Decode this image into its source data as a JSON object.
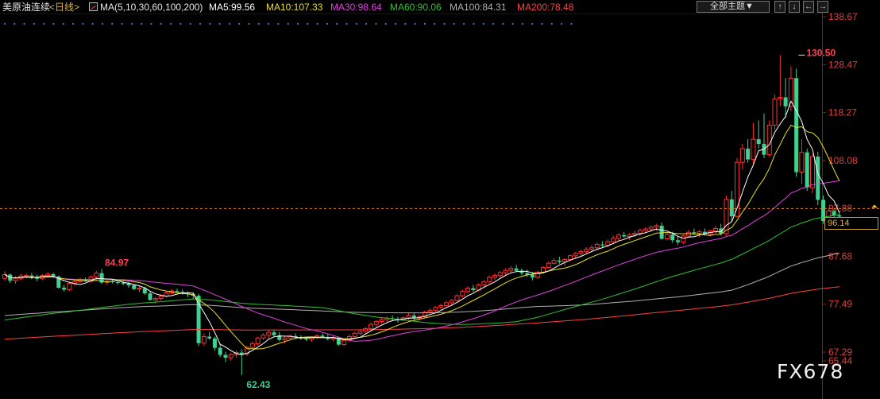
{
  "header": {
    "title": "美原油连续",
    "period": "<日线>",
    "ma_params": "MA(5,10,30,60,100,200)",
    "ma5": "MA5:99.56",
    "ma10": "MA10:107.33",
    "ma30": "MA30:98.64",
    "ma60": "MA60:90.06",
    "ma100": "MA100:84.31",
    "ma200": "MA200:78.48",
    "theme_select": "全部主题▼",
    "btn_up": "↑",
    "btn_down": "↓",
    "btn_left": "←",
    "btn_right": "→"
  },
  "current_price": "96.14",
  "watermark": "FX678",
  "colors": {
    "up": "#ff3030",
    "down": "#40d090",
    "ma5": "#ffffff",
    "ma10": "#e8e020",
    "ma30": "#e040e0",
    "ma60": "#30c030",
    "ma100": "#b0b0b0",
    "ma200": "#ff4040"
  },
  "chart_data": {
    "type": "candlestick",
    "yticks": [
      "138.67",
      "128.47",
      "118.27",
      "108.08",
      "97.88",
      "87.68",
      "77.49",
      "67.29",
      "65.44"
    ],
    "ylim": [
      65.4,
      140.2
    ],
    "annotations": [
      {
        "label": "84.97",
        "value": 84.97,
        "index": 18
      },
      {
        "label": "130.50",
        "value": 130.5,
        "index": 148
      },
      {
        "label": "62.43",
        "value": 62.43,
        "index": 44
      }
    ],
    "candles": [
      [
        83,
        84.5,
        82.5,
        83.8
      ],
      [
        83.8,
        84,
        82,
        82.5
      ],
      [
        82.5,
        83.5,
        81.8,
        83
      ],
      [
        83,
        84,
        82.6,
        83.5
      ],
      [
        83.5,
        84,
        83,
        83.6
      ],
      [
        83.6,
        84.2,
        82.8,
        83.2
      ],
      [
        83.2,
        83.8,
        82.4,
        82.9
      ],
      [
        82.9,
        83.9,
        82.6,
        83.6
      ],
      [
        83.6,
        84.3,
        83.1,
        83.9
      ],
      [
        83.9,
        84.2,
        83.1,
        83.4
      ],
      [
        83.4,
        83.6,
        80.8,
        81
      ],
      [
        81,
        81.6,
        80.2,
        80.6
      ],
      [
        80.6,
        82.1,
        80.3,
        81.9
      ],
      [
        81.9,
        82.6,
        81.4,
        82.3
      ],
      [
        82.3,
        83.1,
        82,
        82.7
      ],
      [
        82.7,
        83.2,
        82.2,
        82.4
      ],
      [
        82.4,
        83.6,
        82.1,
        83.3
      ],
      [
        83.3,
        84.6,
        82.9,
        84.1
      ],
      [
        84.1,
        84.97,
        81.8,
        82.1
      ],
      [
        82.1,
        82.8,
        81.6,
        82.4
      ],
      [
        82.4,
        82.9,
        81.9,
        82.2
      ],
      [
        82.2,
        82.6,
        81.7,
        82
      ],
      [
        82,
        82.4,
        81.5,
        81.9
      ],
      [
        81.9,
        82.2,
        81,
        81.5
      ],
      [
        81.5,
        81.8,
        80.5,
        80.7
      ],
      [
        80.7,
        81.3,
        80,
        80.9
      ],
      [
        80.9,
        81.2,
        79.5,
        79.8
      ],
      [
        79.8,
        80.3,
        78.2,
        78.4
      ],
      [
        78.4,
        79.1,
        77.6,
        78.7
      ],
      [
        78.7,
        79.6,
        78.3,
        79.2
      ],
      [
        79.2,
        80.2,
        78.9,
        79.9
      ],
      [
        79.9,
        80.7,
        79.5,
        80.3
      ],
      [
        80.3,
        80.8,
        79.9,
        80.1
      ],
      [
        80.1,
        80.6,
        79.5,
        79.8
      ],
      [
        79.8,
        80.2,
        79,
        79.6
      ],
      [
        79.6,
        80,
        78.6,
        79.3
      ],
      [
        79.3,
        79.7,
        68.6,
        69.2
      ],
      [
        69.2,
        71.3,
        68.7,
        70.6
      ],
      [
        70.6,
        71.6,
        69.9,
        70.2
      ],
      [
        70.2,
        70.6,
        67.6,
        68.2
      ],
      [
        68.2,
        69.1,
        66.2,
        66.7
      ],
      [
        66.7,
        67.4,
        65.2,
        66.1
      ],
      [
        66.1,
        67.1,
        65.5,
        66.8
      ],
      [
        66.8,
        67.6,
        66.1,
        67.2
      ],
      [
        67.2,
        67.9,
        62.43,
        66.9
      ],
      [
        66.9,
        68.6,
        66.5,
        68.3
      ],
      [
        68.3,
        69.6,
        67.9,
        69.1
      ],
      [
        69.1,
        70.6,
        68.7,
        70.3
      ],
      [
        70.3,
        71.3,
        69.9,
        70.9
      ],
      [
        70.9,
        71.9,
        70.1,
        71.5
      ],
      [
        71.5,
        72.1,
        70.6,
        70.9
      ],
      [
        70.9,
        71.6,
        69.6,
        69.9
      ],
      [
        69.9,
        70.6,
        69.1,
        70.3
      ],
      [
        70.3,
        71.1,
        69.9,
        70.7
      ],
      [
        70.7,
        71.3,
        70.1,
        70.5
      ],
      [
        70.5,
        70.9,
        69.9,
        70.2
      ],
      [
        70.2,
        70.6,
        69.6,
        70
      ],
      [
        70,
        70.6,
        69.5,
        70.4
      ],
      [
        70.4,
        71.1,
        70.1,
        70.8
      ],
      [
        70.8,
        71.3,
        70.3,
        70.5
      ],
      [
        70.5,
        71.1,
        69.8,
        70.1
      ],
      [
        70.1,
        70.7,
        69.6,
        70.4
      ],
      [
        70.4,
        70.6,
        68.6,
        68.9
      ],
      [
        68.9,
        70.1,
        68.6,
        69.8
      ],
      [
        69.8,
        71.1,
        69.4,
        70.6
      ],
      [
        70.6,
        71.6,
        70.1,
        71.3
      ],
      [
        71.3,
        72.1,
        70.9,
        71.7
      ],
      [
        71.7,
        72.6,
        71.2,
        72.3
      ],
      [
        72.3,
        73.6,
        71.9,
        73.2
      ],
      [
        73.2,
        74.1,
        72.6,
        73.8
      ],
      [
        73.8,
        74.6,
        73.3,
        74.2
      ],
      [
        74.2,
        74.9,
        73.6,
        74.5
      ],
      [
        74.5,
        75.1,
        73.9,
        74.3
      ],
      [
        74.3,
        74.8,
        73.6,
        74.1
      ],
      [
        74.1,
        74.9,
        73.9,
        74.6
      ],
      [
        74.6,
        75.6,
        74.2,
        75.1
      ],
      [
        75.1,
        75.6,
        74.3,
        74.6
      ],
      [
        74.6,
        75.2,
        73.9,
        74.8
      ],
      [
        74.8,
        76.1,
        74.5,
        75.8
      ],
      [
        75.8,
        76.6,
        75.3,
        76.2
      ],
      [
        76.2,
        77.1,
        75.9,
        76.8
      ],
      [
        76.8,
        77.6,
        76.3,
        77.2
      ],
      [
        77.2,
        78.2,
        76.9,
        77.8
      ],
      [
        77.8,
        78.6,
        77.3,
        78.3
      ],
      [
        78.3,
        79.6,
        78.1,
        79.3
      ],
      [
        79.3,
        80.6,
        78.9,
        80.2
      ],
      [
        80.2,
        81.3,
        79.8,
        80.9
      ],
      [
        80.9,
        81.6,
        80.1,
        80.5
      ],
      [
        80.5,
        81.9,
        80.2,
        81.6
      ],
      [
        81.6,
        82.6,
        81.2,
        82.3
      ],
      [
        82.3,
        83.6,
        81.9,
        83.2
      ],
      [
        83.2,
        84.1,
        82.6,
        83.6
      ],
      [
        83.6,
        84.6,
        83.1,
        84.2
      ],
      [
        84.2,
        85.1,
        83.6,
        84.7
      ],
      [
        84.7,
        85.6,
        84.2,
        85.1
      ],
      [
        85.1,
        85.9,
        84.3,
        84.6
      ],
      [
        84.6,
        85.1,
        83.6,
        84.1
      ],
      [
        84.1,
        84.9,
        83.3,
        83.8
      ],
      [
        83.8,
        84.3,
        82.6,
        83.2
      ],
      [
        83.2,
        84.6,
        82.9,
        84.3
      ],
      [
        84.3,
        85.6,
        84.1,
        85.3
      ],
      [
        85.3,
        86.6,
        85.1,
        86.2
      ],
      [
        86.2,
        87.3,
        85.9,
        86.8
      ],
      [
        86.8,
        87.6,
        86.1,
        86.5
      ],
      [
        86.5,
        87.3,
        85.6,
        87
      ],
      [
        87,
        88.1,
        86.6,
        87.8
      ],
      [
        87.8,
        88.6,
        87.2,
        88.3
      ],
      [
        88.3,
        89.1,
        87.6,
        88.7
      ],
      [
        88.7,
        89.6,
        88.2,
        89.2
      ],
      [
        89.2,
        90.1,
        88.6,
        89.5
      ],
      [
        89.5,
        90.6,
        88.9,
        90.2
      ],
      [
        90.2,
        90.9,
        89.6,
        90
      ],
      [
        90,
        91.3,
        89.6,
        90.8
      ],
      [
        90.8,
        92.1,
        90.3,
        91.5
      ],
      [
        91.5,
        92.6,
        90.9,
        92.2
      ],
      [
        92.2,
        92.9,
        91.6,
        91.9
      ],
      [
        91.9,
        92.6,
        91.2,
        92.3
      ],
      [
        92.3,
        93.1,
        91.8,
        92.6
      ],
      [
        92.6,
        93.6,
        92.1,
        93.2
      ],
      [
        93.2,
        93.9,
        92.6,
        93.5
      ],
      [
        93.5,
        94.3,
        92.9,
        93.9
      ],
      [
        93.9,
        94.6,
        93.1,
        94.2
      ],
      [
        94.2,
        94.9,
        91.2,
        91.4
      ],
      [
        91.4,
        92.6,
        91.1,
        92.3
      ],
      [
        92.3,
        92.9,
        90.6,
        91.1
      ],
      [
        91.1,
        91.9,
        90.2,
        90.7
      ],
      [
        90.7,
        92.3,
        90.3,
        92
      ],
      [
        92,
        93.3,
        91.6,
        92.8
      ],
      [
        92.8,
        93.6,
        92.1,
        92.6
      ],
      [
        92.6,
        93.3,
        91.8,
        92.9
      ],
      [
        92.9,
        93.6,
        92.1,
        92.4
      ],
      [
        92.4,
        93.3,
        91.9,
        93.1
      ],
      [
        93.1,
        94.1,
        92.6,
        93.6
      ],
      [
        93.6,
        94.6,
        92.1,
        92.5
      ],
      [
        92.5,
        100.6,
        92.1,
        99.8
      ],
      [
        99.8,
        101.6,
        95.1,
        96.2
      ],
      [
        96.2,
        108.6,
        95.9,
        107.7
      ],
      [
        107.7,
        111.6,
        106.1,
        110.6
      ],
      [
        110.6,
        112.6,
        107.6,
        108.3
      ],
      [
        108.3,
        116.1,
        107.1,
        112.6
      ],
      [
        112.6,
        116.6,
        110.6,
        111.6
      ],
      [
        111.6,
        118.1,
        108.6,
        109.3
      ],
      [
        109.3,
        116.6,
        108.9,
        115.6
      ],
      [
        115.6,
        122.1,
        114.6,
        121.2
      ],
      [
        121.2,
        130.5,
        119.6,
        121.5
      ],
      [
        121.5,
        125.6,
        117.1,
        119.6
      ],
      [
        119.6,
        128.1,
        118.6,
        125.6
      ],
      [
        125.6,
        127.6,
        104.6,
        105.6
      ],
      [
        105.6,
        112.6,
        103.1,
        109.8
      ],
      [
        109.8,
        110.6,
        101.6,
        102.3
      ],
      [
        102.3,
        109.6,
        101.1,
        108.9
      ],
      [
        108.9,
        109.9,
        98.6,
        99.7
      ],
      [
        99.7,
        100.6,
        94.6,
        95.2
      ],
      [
        95.2,
        97.9,
        94.1,
        97.3
      ],
      [
        97.3,
        97.9,
        95.4,
        96.4
      ],
      [
        96.4,
        97.3,
        95.6,
        96.14
      ]
    ]
  }
}
